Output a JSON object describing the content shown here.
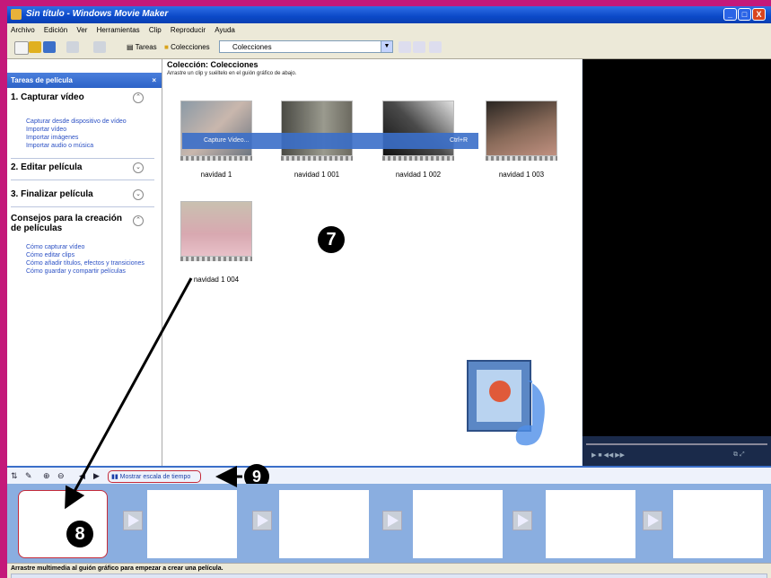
{
  "window": {
    "title": "Sin título - Windows Movie Maker",
    "controls": [
      "_",
      "□",
      "X"
    ]
  },
  "menu": [
    "Archivo",
    "Edición",
    "Ver",
    "Herramientas",
    "Clip",
    "Reproducir",
    "Ayuda"
  ],
  "toolbar": {
    "tasks_label": "Tareas",
    "collections_label": "Colecciones",
    "collection_combo": "Colecciones"
  },
  "tasks_pane": {
    "header": "Tareas de película",
    "sections": [
      {
        "title": "1. Capturar vídeo",
        "links": [
          "Capturar desde dispositivo de vídeo",
          "Importar vídeo",
          "Importar imágenes",
          "Importar audio o música"
        ]
      },
      {
        "title": "2. Editar película",
        "links": []
      },
      {
        "title": "3. Finalizar película",
        "links": []
      },
      {
        "title": "Consejos para la creación de películas",
        "links": [
          "Cómo capturar vídeo",
          "Cómo editar clips",
          "Cómo añadir títulos, efectos y transiciones",
          "Cómo guardar y compartir películas"
        ]
      }
    ]
  },
  "collection": {
    "title": "Colección: Colecciones",
    "subtitle": "Arrastre un clip y suéltelo en el guión gráfico de abajo.",
    "clips": [
      "navidad 1",
      "navidad 1 001",
      "navidad 1 002",
      "navidad 1 003",
      "navidad 1 004"
    ],
    "overlay_left": "Capture Video...",
    "overlay_right": "Ctrl+R"
  },
  "storyboard": {
    "show_timescale_label": "Mostrar escala de tiempo",
    "status": "Arrastre multimedia al guión gráfico para empezar a crear una película."
  },
  "callouts": [
    "7",
    "8",
    "9"
  ],
  "colors": {
    "frame": "#c4197a",
    "accent_red": "#c42b3a",
    "title_blue": "#0b49c8"
  }
}
